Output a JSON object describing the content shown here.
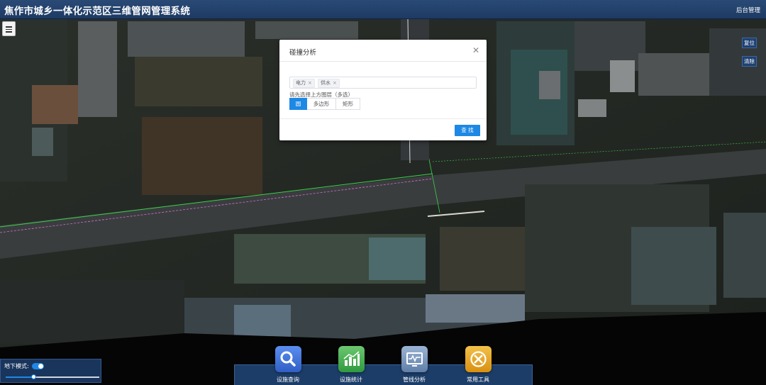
{
  "header": {
    "title": "焦作市城乡一体化示范区三维管网管理系统",
    "admin_link": "后台管理"
  },
  "side_buttons": {
    "reset": "复位",
    "clear": "清除"
  },
  "dialog": {
    "title": "碰撞分析",
    "close_icon": "close-icon",
    "selected_layers": [
      "电力",
      "供水"
    ],
    "hint": "请先选择上方图层（多选）",
    "shapes": [
      "圆",
      "多边形",
      "矩形"
    ],
    "active_shape": "圆",
    "find_button": "查 找"
  },
  "underground": {
    "label": "地下模式:",
    "enabled": true,
    "level": 0.3
  },
  "toolbar": {
    "items": [
      {
        "label": "设施查询",
        "icon": "search-icon",
        "color": "#3b6fd6"
      },
      {
        "label": "设施统计",
        "icon": "bar-chart-icon",
        "color": "#3aa84c"
      },
      {
        "label": "管线分析",
        "icon": "monitor-icon",
        "color": "#6e8fb8"
      },
      {
        "label": "常用工具",
        "icon": "tools-icon",
        "color": "#e3a41c"
      }
    ]
  },
  "colors": {
    "header": "#1d3a63",
    "accent": "#1e88e5"
  }
}
